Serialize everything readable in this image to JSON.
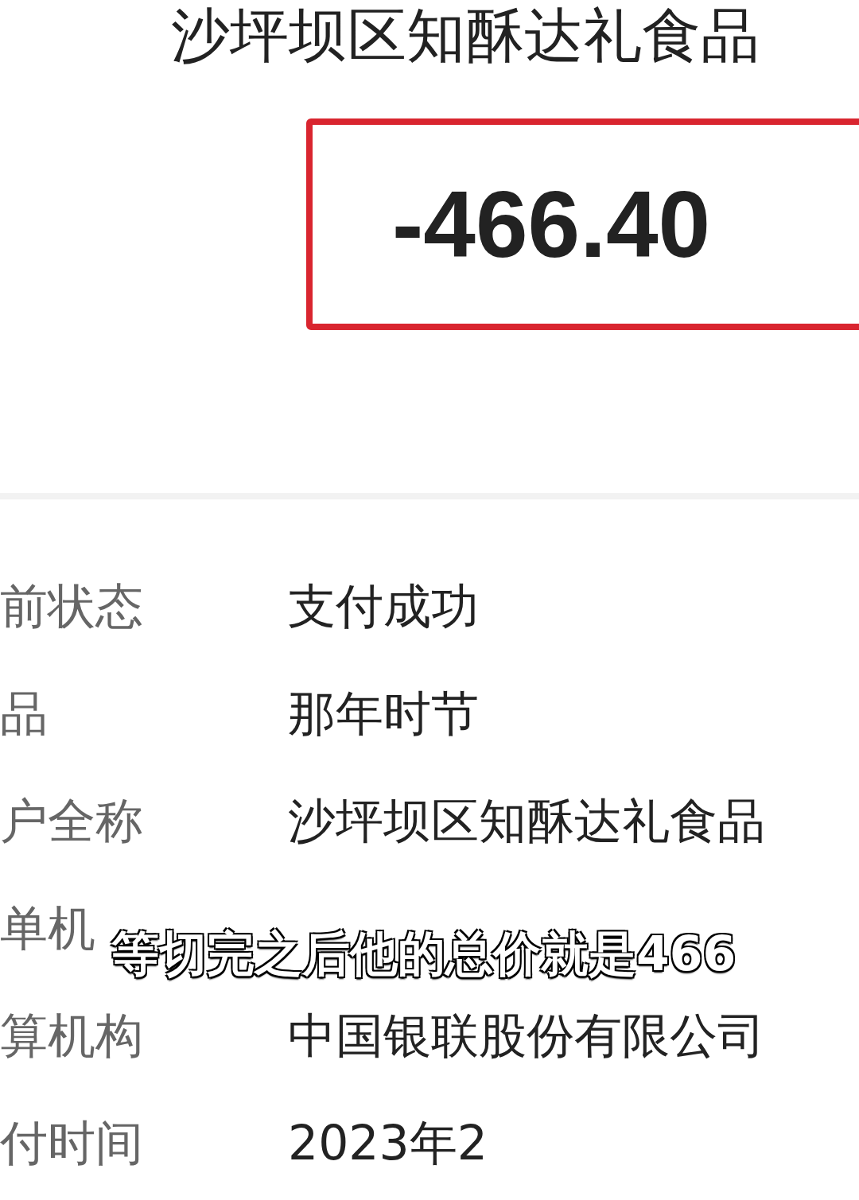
{
  "merchant_title": "沙坪坝区知酥达礼食品",
  "amount": "-466.40",
  "details": [
    {
      "label": "前状态",
      "value": "支付成功"
    },
    {
      "label": "品",
      "value": "那年时节"
    },
    {
      "label": "户全称",
      "value": "沙坪坝区知酥达礼食品"
    },
    {
      "label": "单机"
    },
    {
      "label": "算机构",
      "value": "中国银联股份有限公司"
    },
    {
      "label": "付时间",
      "value": "2023年2"
    }
  ],
  "subtitle": "等切完之后他的总价就是466"
}
